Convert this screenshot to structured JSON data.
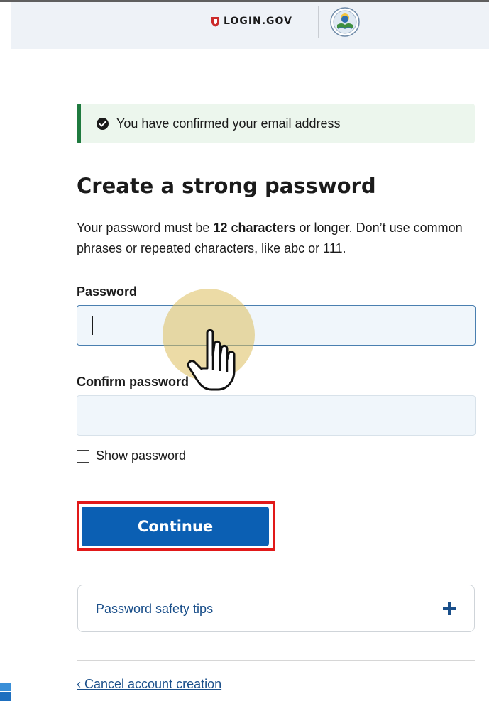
{
  "header": {
    "brand": "LOGIN.GOV",
    "colors": {
      "background": "#eef2f7",
      "shield": "#cc2b2b"
    },
    "icons": {
      "brand_icon": "shield-icon",
      "agency_seal": "epa-seal-icon"
    }
  },
  "alert": {
    "message": "You have confirmed your email address",
    "icon": "check-circle-icon",
    "colors": {
      "background": "#ecf6ed",
      "border": "#1f7a3f"
    }
  },
  "page": {
    "title": "Create a strong password",
    "description": {
      "part1": "Your password must be ",
      "bold": "12 characters",
      "part2": " or longer. Don’t use common phrases or repeated characters, like abc or 111."
    }
  },
  "form": {
    "password_label": "Password",
    "password_value": "",
    "confirm_label": "Confirm password",
    "confirm_value": "",
    "show_password_label": "Show password",
    "show_password_checked": false
  },
  "actions": {
    "continue_label": "Continue",
    "colors": {
      "button": "#0b5fb3",
      "highlight": "#e11919"
    }
  },
  "accordion": {
    "label": "Password safety tips",
    "icon": "plus-icon",
    "expanded": false
  },
  "footer": {
    "cancel_label": "‹ Cancel account creation"
  },
  "overlay": {
    "cursor": "hand-pointer-icon",
    "halo_color": "#ddbe5c"
  }
}
